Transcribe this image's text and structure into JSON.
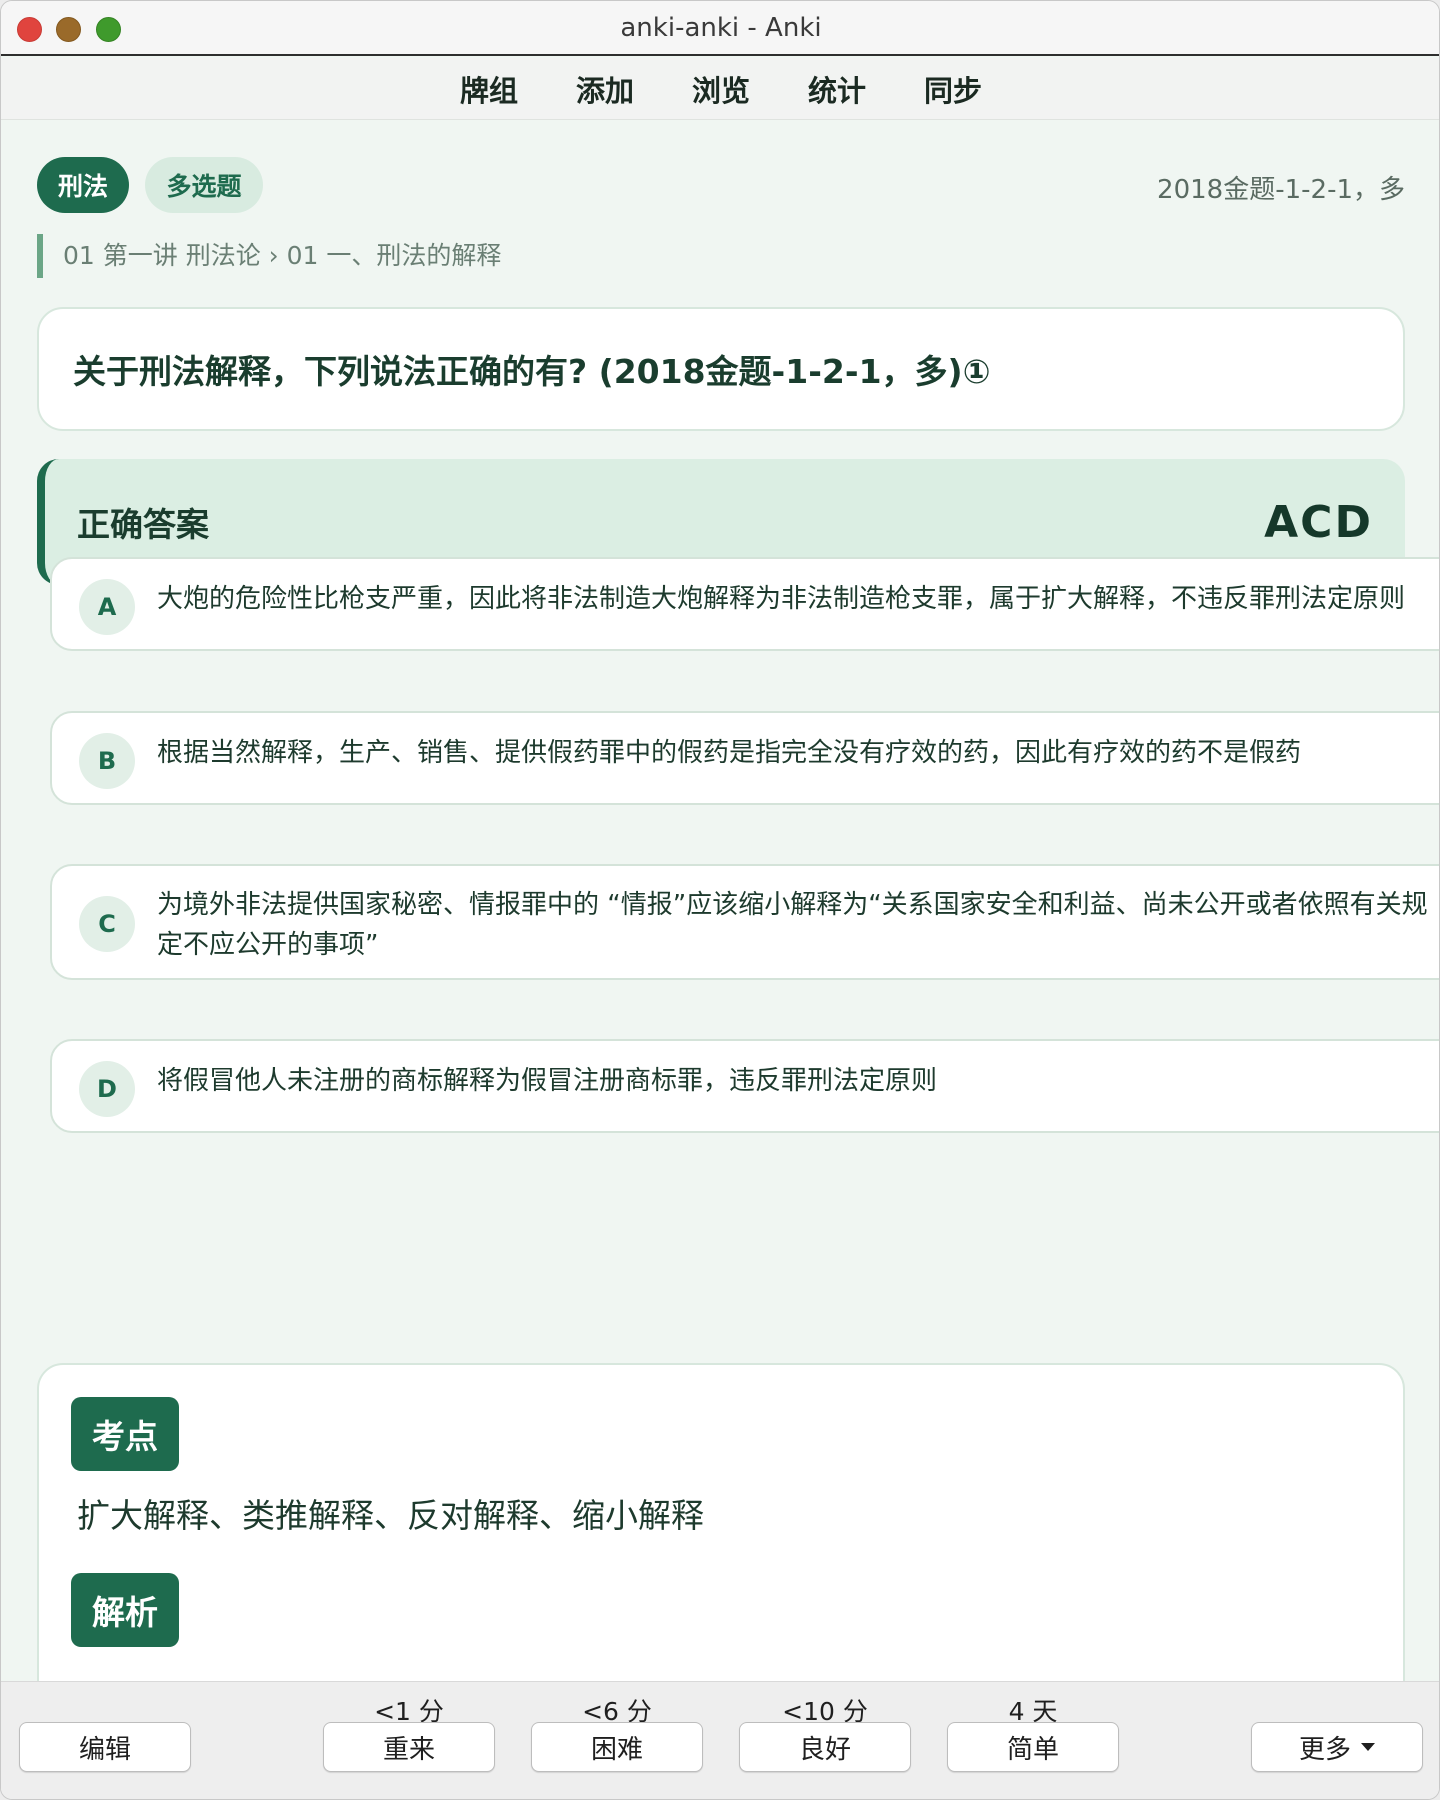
{
  "window": {
    "title": "anki-anki - Anki"
  },
  "menu": {
    "items": [
      "牌组",
      "添加",
      "浏览",
      "统计",
      "同步"
    ]
  },
  "card": {
    "subject_tag": "刑法",
    "type_tag": "多选题",
    "source": "2018金题-1-2-1，多",
    "breadcrumb": "01 第一讲 刑法论 › 01 一、刑法的解释",
    "question": "关于刑法解释，下列说法正确的有? (2018金题-1-2-1，多)①",
    "answer_label": "正确答案",
    "answer_value": "ACD",
    "options": [
      {
        "letter": "A",
        "text": "大炮的危险性比枪支严重，因此将非法制造大炮解释为非法制造枪支罪，属于扩大解释，不违反罪刑法定原则"
      },
      {
        "letter": "B",
        "text": "根据当然解释，生产、销售、提供假药罪中的假药是指完全没有疗效的药，因此有疗效的药不是假药"
      },
      {
        "letter": "C",
        "text": "为境外非法提供国家秘密、情报罪中的 “情报”应该缩小解释为“关系国家安全和利益、尚未公开或者依照有关规定不应公开的事项”"
      },
      {
        "letter": "D",
        "text": "将假冒他人未注册的商标解释为假冒注册商标罪，违反罪刑法定原则"
      }
    ],
    "keypoint_label": "考点",
    "keypoint_text": "扩大解释、类推解释、反对解释、缩小解释",
    "analysis_label": "解析"
  },
  "bottom": {
    "edit": "编辑",
    "more": "更多",
    "answers": [
      {
        "ease": "<1 分",
        "label": "重来"
      },
      {
        "ease": "<6 分",
        "label": "困难"
      },
      {
        "ease": "<10 分",
        "label": "良好"
      },
      {
        "ease": "4 天",
        "label": "简单"
      }
    ]
  }
}
